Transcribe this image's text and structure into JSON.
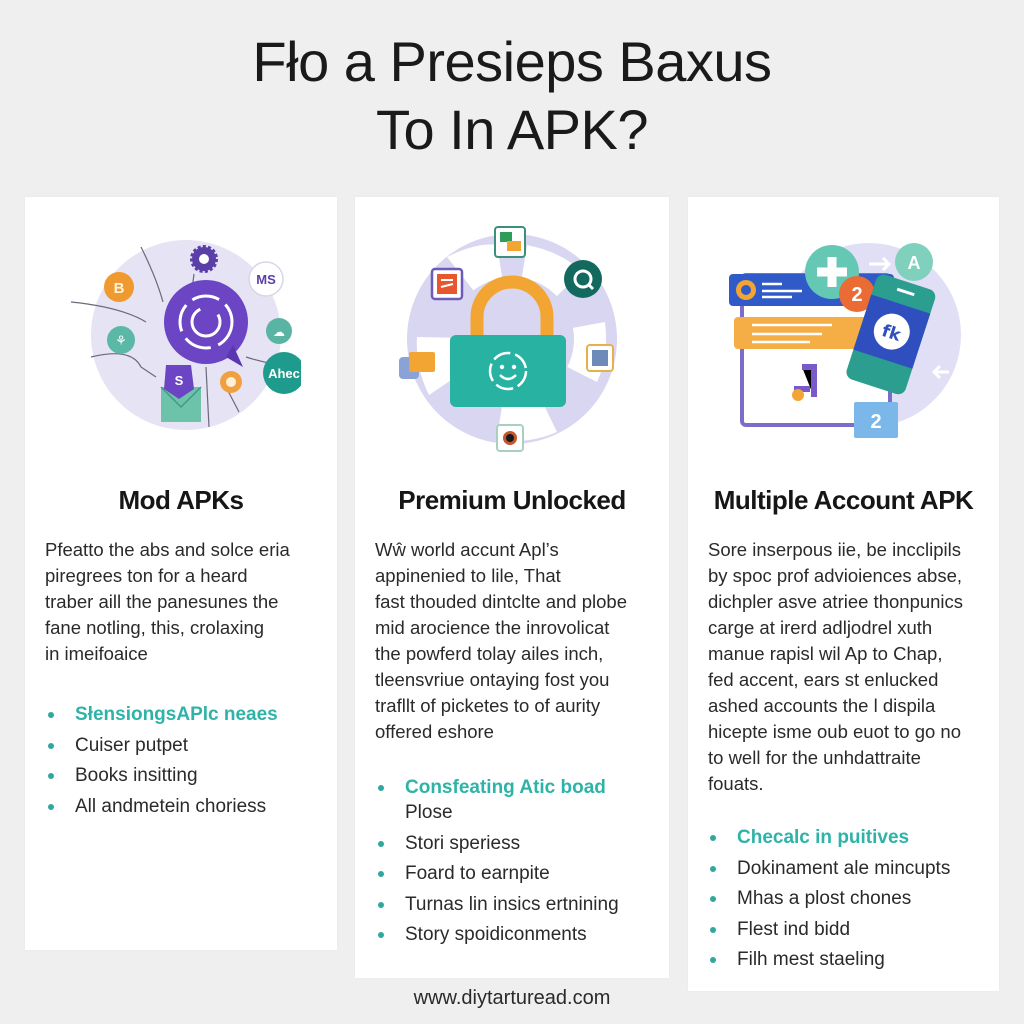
{
  "title": {
    "line1": "Fło a Presieps Baxus",
    "line2": "To In APK?"
  },
  "colors": {
    "accent_teal": "#2fb3a8",
    "purple": "#6b45c4",
    "lavender": "#e3e1f5",
    "orange": "#f2a533"
  },
  "cards": [
    {
      "heading": "Mod APKs",
      "illustration": "network-hub-illustration",
      "body": [
        "Pfeatto the abs and solce eria",
        "piregrees ton for a heard",
        "traber aill the panesunes the",
        "fane notling, this, crolaxing",
        "in imeifoaice"
      ],
      "bullets": [
        {
          "text": "SłensiongsAPlc neaes",
          "accent": true
        },
        {
          "text": "Cuiser putpet",
          "accent": false
        },
        {
          "text": "Books insitting",
          "accent": false
        },
        {
          "text": "All andmetein choriess",
          "accent": false
        }
      ]
    },
    {
      "heading": "Premium Unlocked",
      "illustration": "unlocked-padlock-illustration",
      "body": [
        "Wŵ world accunt Apl’s",
        "appinenied to lile, That",
        "fast thouded dintclte and plobe",
        "mid arocience the inrovolicat",
        "the powferd tolay ailes inch,",
        "tleensvriue ontaying fost you",
        "trafllt of picketes to of aurity",
        "offered eshore"
      ],
      "bullets": [
        {
          "text": "Consfeating Atic boad Plose",
          "accent_part": "Consfeating Atic boad",
          "rest": "Plose",
          "accent": true
        },
        {
          "text": "Stori speriess",
          "accent": false
        },
        {
          "text": "Foard to earnpite",
          "accent": false
        },
        {
          "text": "Turnas lin insics ertnining",
          "accent": false
        },
        {
          "text": "Story spoidiconments",
          "accent": false
        }
      ]
    },
    {
      "heading": "Multiple Account APK",
      "illustration": "multiple-account-illustration",
      "body": [
        "Sore inserpous iie, be incclipils",
        "by spoc prof advioiences abse,",
        "dichpler asve atriee thonpunics",
        "carge at irerd adljodrel xuth",
        "manue rapisl wil Ap to Chap,",
        "fed accent, ears st enlucked",
        "ashed accounts the l dispila",
        "hicepte isme oub euot to go no",
        "to well for the unhdattraite",
        "fouats."
      ],
      "bullets": [
        {
          "text": "Checalc in puitives",
          "accent": true
        },
        {
          "text": "Dokinament ale mincupts",
          "accent": false
        },
        {
          "text": "Mhas a plost chones",
          "accent": false
        },
        {
          "text": "Flest ind bidd",
          "accent": false
        },
        {
          "text": "Filh mest staeling",
          "accent": false
        }
      ]
    }
  ],
  "illustration_labels": {
    "mod_b": "B",
    "mod_ms": "MS",
    "mod_s": "S",
    "mod_ahec": "Ahec",
    "multi_a": "A",
    "multi_2a": "2",
    "multi_2b": "2"
  },
  "footer": {
    "url": "www.dіytarturead.com"
  }
}
